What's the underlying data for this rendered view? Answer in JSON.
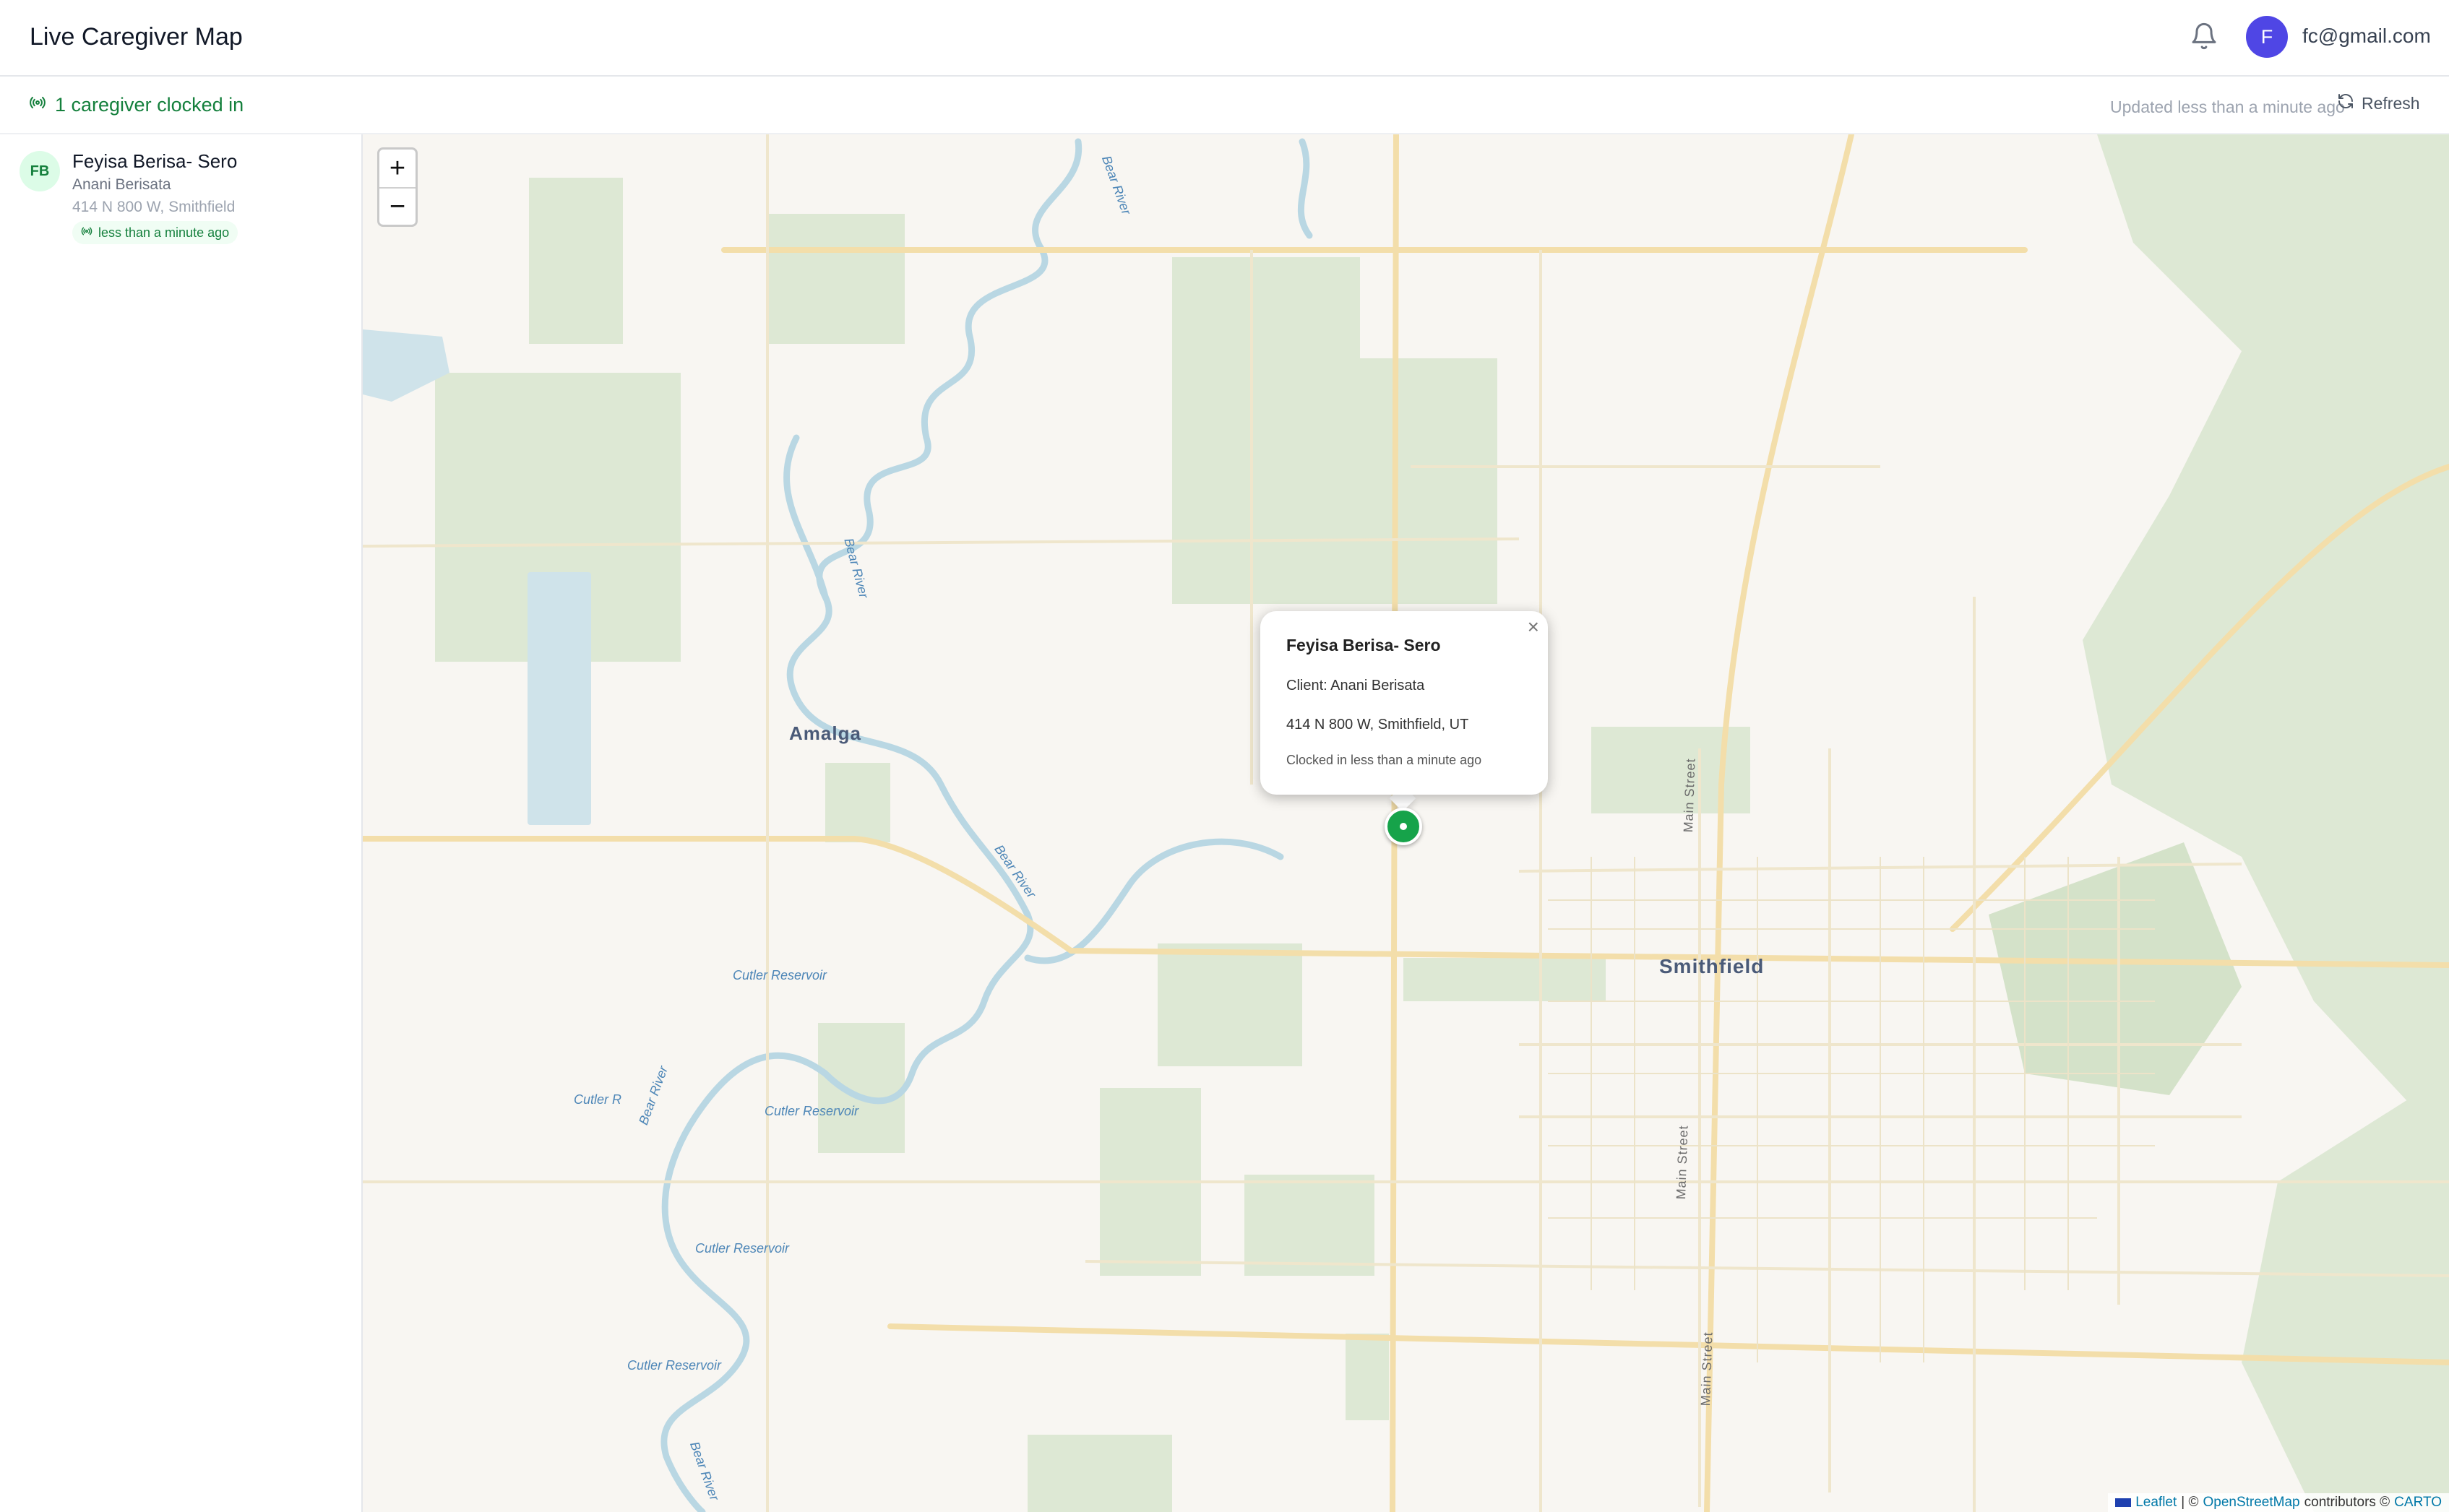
{
  "header": {
    "title": "Live Caregiver Map",
    "bell_icon": "bell-icon",
    "avatar_initial": "F",
    "user_email": "fc@gmail.com"
  },
  "status": {
    "clocked_in_text": "1 caregiver clocked in",
    "updated_text": "Updated less than a minute ago",
    "refresh_label": "Refresh"
  },
  "sidebar": {
    "caregivers": [
      {
        "initials": "FB",
        "name": "Feyisa Berisa- Sero",
        "client": "Anani Berisata",
        "address": "414 N 800 W, Smithfield",
        "badge": "less than a minute ago"
      }
    ]
  },
  "map": {
    "zoom_in": "+",
    "zoom_out": "−",
    "labels": {
      "amalga": "Amalga",
      "smithfield": "Smithfield",
      "bear_river_1": "Bear River",
      "bear_river_2": "Bear River",
      "bear_river_3": "Bear River",
      "bear_river_4": "Bear River",
      "bear_river_5": "Bear River",
      "cutler_1": "Cutler Reservoir",
      "cutler_2": "Cutler Reservoir",
      "cutler_3": "Cutler Reservoir",
      "cutler_4": "Cutler Reservoir",
      "cutler_5": "Cutler R",
      "main_street_1": "Main Street",
      "main_street_2": "Main Street",
      "main_street_3": "Main Street"
    },
    "popup": {
      "title": "Feyisa Berisa- Sero",
      "client": "Client: Anani Berisata",
      "address": "414 N 800 W, Smithfield, UT",
      "time": "Clocked in less than a minute ago",
      "close": "×"
    },
    "attribution": {
      "leaflet": "Leaflet",
      "sep1": "| ©",
      "osm": "OpenStreetMap",
      "contributors": "contributors ©",
      "carto": "CARTO"
    }
  },
  "colors": {
    "accent": "#4f46e5",
    "success": "#15803d",
    "marker": "#16a34a",
    "park": "#dde8d4",
    "water": "#cfe3ea",
    "road": "#f7e3a3"
  }
}
